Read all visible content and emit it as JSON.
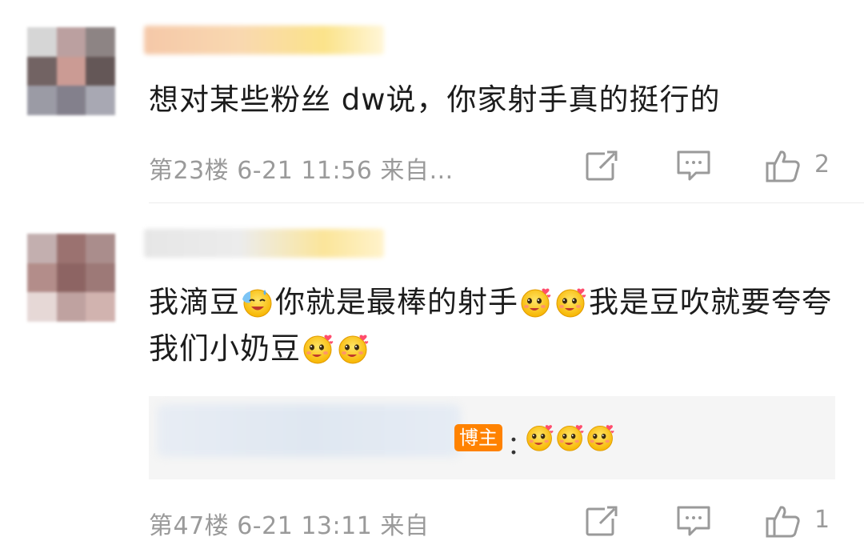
{
  "comments": [
    {
      "text": "想对某些粉丝 dw说，你家射手真的挺行的",
      "meta": "第23楼 6-21 11:56 来自…",
      "like_count": "2"
    },
    {
      "text_part1": "我滴豆",
      "text_part2": "你就是最棒的射手",
      "text_part3": "我是豆吹就要夸夸我们小奶豆",
      "meta": "第47楼 6-21 13:11 来自",
      "like_count": "1",
      "reply": {
        "badge": "博主",
        "colon": "："
      }
    }
  ],
  "icons": {
    "share": "share-edit-icon",
    "comment": "comment-icon",
    "like": "thumbs-up-icon",
    "emoji_sweat": "sweat-smile-emoji-icon",
    "emoji_love": "love-face-emoji-icon"
  },
  "colors": {
    "meta_text": "#9a9a9a",
    "badge_bg": "#ff8200",
    "reply_bg": "#f5f5f5"
  }
}
